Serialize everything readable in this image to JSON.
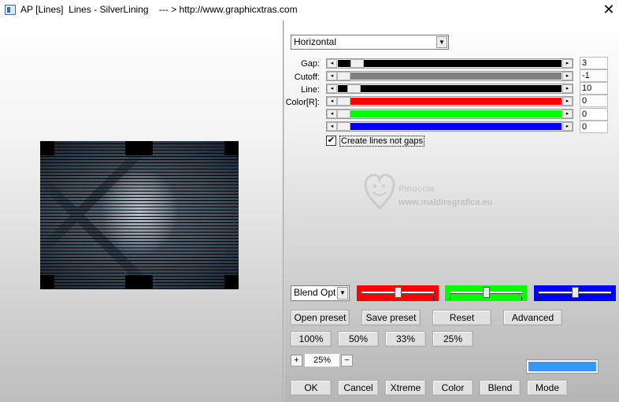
{
  "window": {
    "title": "AP [Lines]  Lines - SilverLining    --- > http://www.graphicxtras.com",
    "close_glyph": "✕"
  },
  "direction_select": {
    "value": "Horizontal",
    "arrow": "▼"
  },
  "params": {
    "gap": {
      "label": "Gap:",
      "value": "3"
    },
    "cutoff": {
      "label": "Cutoff:",
      "value": "-1"
    },
    "line": {
      "label": "Line:",
      "value": "10"
    },
    "color_r": {
      "label": "Color[R]:",
      "value": "0"
    },
    "color_g": {
      "value": "0"
    },
    "color_b": {
      "value": "0"
    }
  },
  "slider_arrows": {
    "left": "◂",
    "right": "▸"
  },
  "create_lines_checkbox": {
    "label": "Create lines not gaps",
    "checked": true,
    "mark": "✔"
  },
  "watermark": {
    "name": "Pinuccia",
    "url": "www.maldiregrafica.eu"
  },
  "blend_select": {
    "value": "Blend Optio",
    "arrow": "▼"
  },
  "color_sliders": [
    {
      "color": "#ff0000",
      "level": 0.5
    },
    {
      "color": "#00ff00",
      "level": 0.5
    },
    {
      "color": "#0000ff",
      "level": 0.5
    }
  ],
  "buttons_row1": {
    "open_preset": "Open preset",
    "save_preset": "Save preset",
    "reset": "Reset",
    "advanced": "Advanced"
  },
  "zoom_buttons": {
    "z100": "100%",
    "z50": "50%",
    "z33": "33%",
    "z25": "25%"
  },
  "zoom": {
    "plus": "+",
    "minus": "−",
    "value": "25%"
  },
  "preview_color": "#3399ff",
  "buttons_bottom": {
    "ok": "OK",
    "cancel": "Cancel",
    "xtreme": "Xtreme",
    "color": "Color",
    "blend": "Blend",
    "mode": "Mode"
  }
}
